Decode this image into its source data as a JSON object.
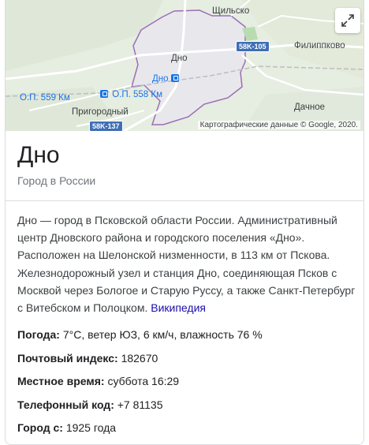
{
  "map": {
    "labels": {
      "shchilsko": "Щильско",
      "dno": "Дно",
      "filippkovo": "Филиппково",
      "op559": "О.П. 559 Км",
      "dno_station": "Дно",
      "op558": "О.П. 558 Км",
      "prigorodny": "Пригородный",
      "dachnoe": "Дачное"
    },
    "road_shields": [
      "58K-105",
      "58K-137"
    ],
    "credit": "Картографические данные © Google, 2020.",
    "expand_icon": "expand-icon",
    "colors": {
      "land": "#e6ede1",
      "city": "#e8e8ec",
      "border": "#9b6fb5",
      "shield": "#3f6fb5",
      "link": "#1a73e8"
    }
  },
  "header": {
    "title": "Дно",
    "subtitle": "Город в России"
  },
  "description": {
    "text": "Дно — город в Псковской области России. Административный центр Дновского района и городского поселения «Дно». Расположен на Шелонской низменности, в 113 км от Пскова. Железнодорожный узел и станция Дно, соединяющая Псков с Москвой через Бологое и Старую Руссу, а также Санкт-Петербург с Витебском и Полоцком.",
    "source_link": "Википедия"
  },
  "facts": [
    {
      "label": "Погода:",
      "value": "7°C, ветер ЮЗ, 6 км/ч, влажность 76 %"
    },
    {
      "label": "Почтовый индекс:",
      "value": "182670"
    },
    {
      "label": "Местное время:",
      "value": "суббота 16:29"
    },
    {
      "label": "Телефонный код:",
      "value": "+7 81135"
    },
    {
      "label": "Город с:",
      "value": "1925 года"
    }
  ]
}
